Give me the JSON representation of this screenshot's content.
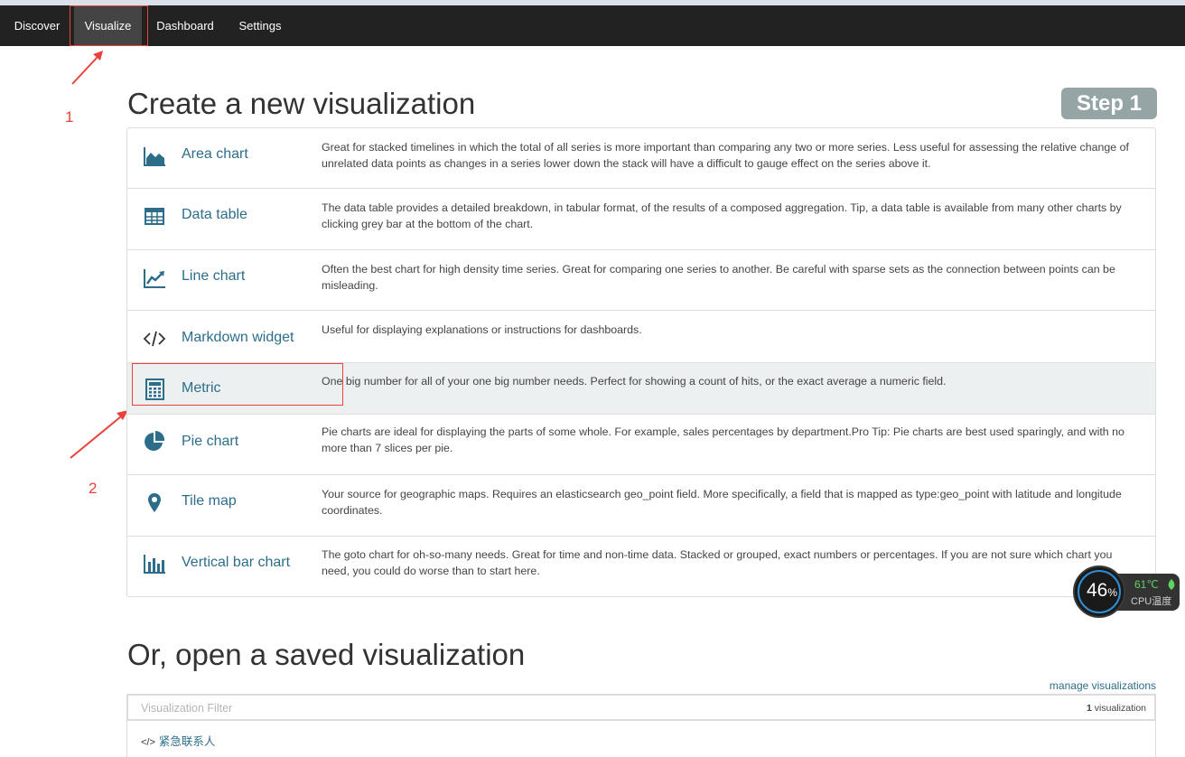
{
  "nav": {
    "items": [
      {
        "label": "Discover"
      },
      {
        "label": "Visualize"
      },
      {
        "label": "Dashboard"
      },
      {
        "label": "Settings"
      }
    ],
    "active": "Visualize"
  },
  "annotations": {
    "marker_1": "1",
    "marker_2": "2",
    "color": "#e8423b"
  },
  "create": {
    "title": "Create a new visualization",
    "step_badge": "Step 1",
    "types": [
      {
        "name": "Area chart",
        "icon": "area-chart-icon",
        "description": "Great for stacked timelines in which the total of all series is more important than comparing any two or more series. Less useful for assessing the relative change of unrelated data points as changes in a series lower down the stack will have a difficult to gauge effect on the series above it."
      },
      {
        "name": "Data table",
        "icon": "table-icon",
        "description": "The data table provides a detailed breakdown, in tabular format, of the results of a composed aggregation. Tip, a data table is available from many other charts by clicking grey bar at the bottom of the chart."
      },
      {
        "name": "Line chart",
        "icon": "line-chart-icon",
        "description": "Often the best chart for high density time series. Great for comparing one series to another. Be careful with sparse sets as the connection between points can be misleading."
      },
      {
        "name": "Markdown widget",
        "icon": "code-icon",
        "description": "Useful for displaying explanations or instructions for dashboards."
      },
      {
        "name": "Metric",
        "icon": "calculator-icon",
        "description": "One big number for all of your one big number needs. Perfect for showing a count of hits, or the exact average a numeric field."
      },
      {
        "name": "Pie chart",
        "icon": "pie-chart-icon",
        "description": "Pie charts are ideal for displaying the parts of some whole. For example, sales percentages by department.Pro Tip: Pie charts are best used sparingly, and with no more than 7 slices per pie."
      },
      {
        "name": "Tile map",
        "icon": "map-marker-icon",
        "description": "Your source for geographic maps. Requires an elasticsearch geo_point field. More specifically, a field that is mapped as type:geo_point with latitude and longitude coordinates."
      },
      {
        "name": "Vertical bar chart",
        "icon": "bar-chart-icon",
        "description": "The goto chart for oh-so-many needs. Great for time and non-time data. Stacked or grouped, exact numbers or percentages. If you are not sure which chart you need, you could do worse than to start here."
      }
    ]
  },
  "saved": {
    "title": "Or, open a saved visualization",
    "manage_link": "manage visualizations",
    "filter_placeholder": "Visualization Filter",
    "count_number": "1",
    "count_label": "visualization",
    "items": [
      {
        "label": "紧急联系人"
      }
    ]
  },
  "cpu_widget": {
    "percent": "46",
    "percent_sign": "%",
    "temperature": "61℃",
    "label": "CPU温度"
  }
}
